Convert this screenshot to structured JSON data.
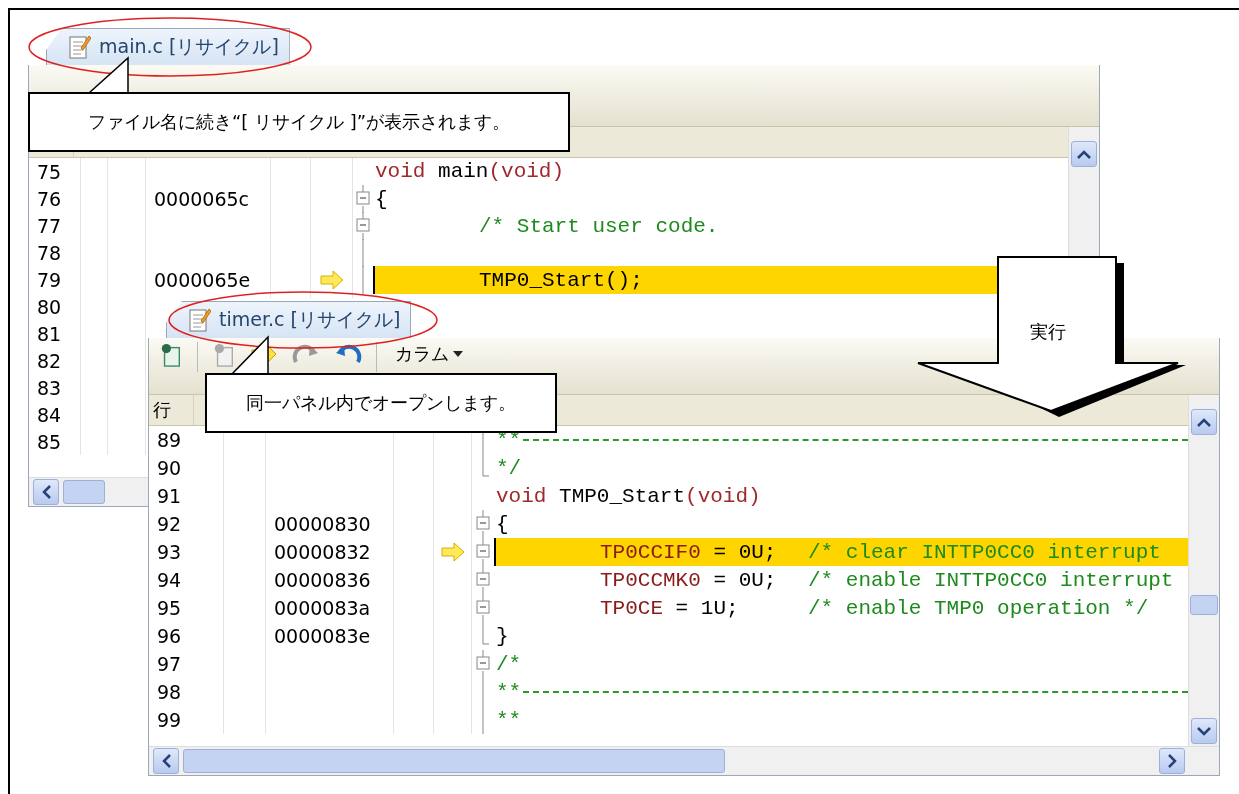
{
  "panels": [
    {
      "tab": {
        "label": "main.c [リサイクル]",
        "selected": true
      },
      "rows": [
        {
          "line": "75",
          "current": false,
          "kind": "plain",
          "indent": false,
          "code": [
            {
              "kind": "keyword",
              "text": "void"
            },
            {
              "kind": "plain",
              "text": " main"
            },
            {
              "kind": "keyword",
              "text": "(void)"
            }
          ]
        },
        {
          "line": "76",
          "address": "0000065c",
          "current": false,
          "kind": "fold",
          "indent": false,
          "code": [
            {
              "kind": "plain",
              "text": "{"
            }
          ]
        },
        {
          "line": "77",
          "current": false,
          "kind": "fold",
          "indent": true,
          "code": [
            {
              "kind": "comment",
              "text": "/* Start user code."
            }
          ]
        },
        {
          "line": "78",
          "current": false,
          "kind": "inner",
          "code": []
        },
        {
          "line": "79",
          "address": "0000065e",
          "current": true,
          "kind": "inner",
          "indent": true,
          "code": [
            {
              "kind": "plain",
              "text": "TMP0_Start();"
            }
          ]
        },
        {
          "line": "80",
          "current": false,
          "kind": "plain",
          "code": []
        },
        {
          "line": "81",
          "current": false,
          "kind": "plain",
          "code": []
        },
        {
          "line": "82",
          "current": false,
          "kind": "plain",
          "code": []
        },
        {
          "line": "83",
          "current": false,
          "kind": "plain",
          "code": []
        },
        {
          "line": "84",
          "current": false,
          "kind": "plain",
          "code": []
        },
        {
          "line": "85",
          "current": false,
          "kind": "plain",
          "code": []
        }
      ]
    },
    {
      "tab": {
        "label": "timer.c [リサイクル]",
        "selected": true
      },
      "toolbar": {
        "column_menu": "カラム"
      },
      "header": {
        "line_column": "行"
      },
      "rows": [
        {
          "line": "89",
          "current": false,
          "kind": "inner",
          "indent": false,
          "rule": true,
          "code": [
            {
              "kind": "comment",
              "text": "**"
            }
          ]
        },
        {
          "line": "90",
          "current": false,
          "kind": "end",
          "indent": false,
          "code": [
            {
              "kind": "comment",
              "text": "*/"
            }
          ]
        },
        {
          "line": "91",
          "current": false,
          "kind": "plain",
          "indent": false,
          "code": [
            {
              "kind": "keyword",
              "text": "void"
            },
            {
              "kind": "plain",
              "text": " TMP0_Start"
            },
            {
              "kind": "keyword",
              "text": "(void)"
            }
          ]
        },
        {
          "line": "92",
          "address": "00000830",
          "current": false,
          "kind": "fold",
          "indent": false,
          "code": [
            {
              "kind": "plain",
              "text": "{"
            }
          ]
        },
        {
          "line": "93",
          "address": "00000832",
          "current": true,
          "kind": "fold",
          "indent": true,
          "code": [
            {
              "kind": "register",
              "text": "TP0CCIF0"
            },
            {
              "kind": "plain",
              "text": " = 0U;"
            }
          ],
          "comment": "/* clear INTTP0CC0 interrupt"
        },
        {
          "line": "94",
          "address": "00000836",
          "current": false,
          "kind": "fold",
          "indent": true,
          "code": [
            {
              "kind": "register",
              "text": "TP0CCMK0"
            },
            {
              "kind": "plain",
              "text": " = 0U;"
            }
          ],
          "comment": "/* enable INTTP0CC0 interrupt"
        },
        {
          "line": "95",
          "address": "0000083a",
          "current": false,
          "kind": "fold",
          "indent": true,
          "code": [
            {
              "kind": "register",
              "text": "TP0CE"
            },
            {
              "kind": "plain",
              "text": " = 1U;"
            }
          ],
          "comment": "/* enable TMP0 operation */"
        },
        {
          "line": "96",
          "address": "0000083e",
          "current": false,
          "kind": "end",
          "indent": false,
          "code": [
            {
              "kind": "plain",
              "text": "}"
            }
          ]
        },
        {
          "line": "97",
          "current": false,
          "kind": "fold",
          "indent": false,
          "code": [
            {
              "kind": "comment",
              "text": "/*"
            }
          ]
        },
        {
          "line": "98",
          "current": false,
          "kind": "inner",
          "indent": false,
          "rule": true,
          "code": [
            {
              "kind": "comment",
              "text": "**"
            }
          ]
        },
        {
          "line": "99",
          "current": false,
          "kind": "inner",
          "indent": false,
          "code": [
            {
              "kind": "comment",
              "text": "**"
            }
          ]
        }
      ]
    }
  ],
  "callouts": [
    {
      "text": "ファイル名に続き“[ リサイクル ]”が表示されます。"
    },
    {
      "text": "同一パネル内でオープンします。"
    }
  ],
  "arrow": {
    "label": "実行"
  }
}
